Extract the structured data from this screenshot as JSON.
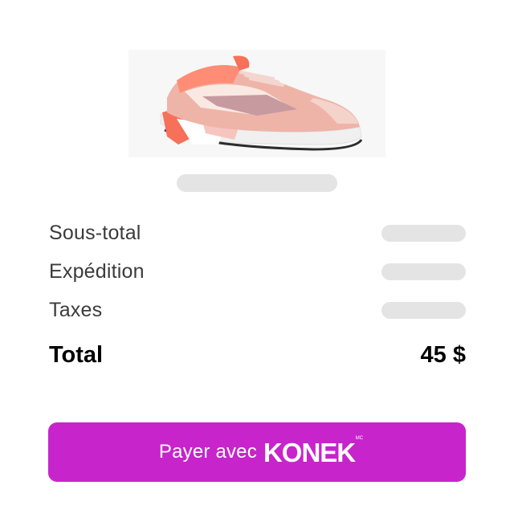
{
  "product": {
    "image_icon": "sneaker-product-image"
  },
  "summary": {
    "rows": [
      {
        "label": "Sous-total"
      },
      {
        "label": "Expédition"
      },
      {
        "label": "Taxes"
      }
    ],
    "total_label": "Total",
    "total_value": "45 $"
  },
  "pay_button": {
    "label": "Payer avec",
    "brand": "KONEK",
    "brand_mark": "MC",
    "color": "#c724cc"
  },
  "colors": {
    "skeleton": "#e4e4e4",
    "text": "#3b3b3b"
  }
}
